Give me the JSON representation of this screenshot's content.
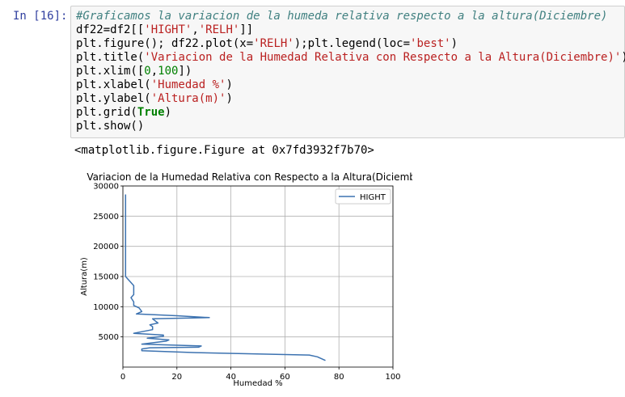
{
  "cell": {
    "prompt": "In [16]:",
    "lines": [
      [
        {
          "t": "#Graficamos la variacion de la humeda relativa respecto a la altura(Diciembre)",
          "c": "comment"
        }
      ],
      [
        {
          "t": "df22=df2[[",
          "c": ""
        },
        {
          "t": "'HIGHT'",
          "c": "str"
        },
        {
          "t": ",",
          "c": ""
        },
        {
          "t": "'RELH'",
          "c": "str"
        },
        {
          "t": "]]",
          "c": ""
        }
      ],
      [
        {
          "t": "plt.figure(); df22.plot(x=",
          "c": ""
        },
        {
          "t": "'RELH'",
          "c": "str"
        },
        {
          "t": ");plt.legend(loc=",
          "c": ""
        },
        {
          "t": "'best'",
          "c": "str"
        },
        {
          "t": ")",
          "c": ""
        }
      ],
      [
        {
          "t": "plt.title(",
          "c": ""
        },
        {
          "t": "'Variacion de la Humedad Relativa con Respecto a la Altura(Diciembre)'",
          "c": "str"
        },
        {
          "t": ")",
          "c": ""
        }
      ],
      [
        {
          "t": "plt.xlim([",
          "c": ""
        },
        {
          "t": "0",
          "c": "num"
        },
        {
          "t": ",",
          "c": ""
        },
        {
          "t": "100",
          "c": "num"
        },
        {
          "t": "])",
          "c": ""
        }
      ],
      [
        {
          "t": "plt.xlabel(",
          "c": ""
        },
        {
          "t": "'Humedad %'",
          "c": "str"
        },
        {
          "t": ")",
          "c": ""
        }
      ],
      [
        {
          "t": "plt.ylabel(",
          "c": ""
        },
        {
          "t": "'Altura(m)'",
          "c": "str"
        },
        {
          "t": ")",
          "c": ""
        }
      ],
      [
        {
          "t": "plt.grid(",
          "c": ""
        },
        {
          "t": "True",
          "c": "kw"
        },
        {
          "t": ")",
          "c": ""
        }
      ],
      [
        {
          "t": "plt.show()",
          "c": ""
        }
      ]
    ]
  },
  "output": {
    "text": "<matplotlib.figure.Figure at 0x7fd3932f7b70>"
  },
  "colors": {
    "line": "#3c72b0",
    "grid": "#b0b0b0",
    "prompt": "#303f9f"
  },
  "chart_data": {
    "type": "line",
    "title": "Variacion de la Humedad Relativa con Respecto a la Altura(Diciembre)",
    "xlabel": "Humedad %",
    "ylabel": "Altura(m)",
    "xlim": [
      0,
      100
    ],
    "ylim": [
      0,
      30000
    ],
    "xticks": [
      "0",
      "20",
      "40",
      "60",
      "80",
      "100"
    ],
    "yticks": [
      "5000",
      "10000",
      "15000",
      "20000",
      "25000",
      "30000"
    ],
    "grid": true,
    "legend_position": "top-right",
    "series": [
      {
        "name": "HIGHT",
        "x": [
          75,
          72,
          69,
          27,
          7,
          7,
          10,
          28,
          29,
          7,
          16,
          17,
          9,
          15,
          15,
          4,
          11,
          11,
          10,
          13,
          11,
          32,
          20,
          5,
          7,
          6,
          4,
          4,
          3,
          4,
          4,
          1,
          1,
          1,
          1,
          1,
          1,
          1,
          1
        ],
        "y": [
          1100,
          1700,
          2000,
          2400,
          2700,
          3000,
          3200,
          3300,
          3500,
          3800,
          4300,
          4500,
          4800,
          5100,
          5300,
          5600,
          6200,
          6700,
          7000,
          7300,
          8000,
          8200,
          8500,
          8800,
          9200,
          9800,
          10200,
          10800,
          11500,
          12000,
          13500,
          15000,
          17000,
          19000,
          21000,
          23000,
          25000,
          27000,
          28600
        ]
      }
    ]
  }
}
